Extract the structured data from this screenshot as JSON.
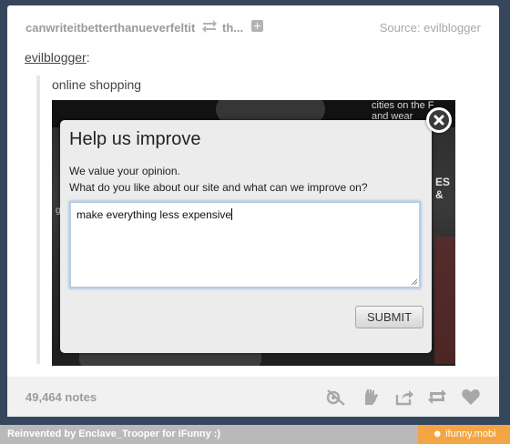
{
  "header": {
    "reblogger": "canwriteitbetterthanueverfeltit",
    "reblogged_from_short": "th...",
    "source_label": "Source: evilblogger"
  },
  "post": {
    "quoted_user": "evilblogger",
    "quoted_colon": ":",
    "caption": "online shopping"
  },
  "background_photo_text": {
    "top_right": "cities on the F",
    "top_right_2": "and wear",
    "mid_right": "ES &",
    "mid_left": "g i"
  },
  "dialog": {
    "title": "Help us improve",
    "line1": "We value your opinion.",
    "line2": "What do you like about our site and what can we improve on?",
    "input_value": "make everything less expensive",
    "submit_label": "SUBMIT"
  },
  "footer": {
    "notes": "49,464 notes",
    "icons": [
      "share-icon",
      "like-hand-icon",
      "share-arrow-icon",
      "reblog-icon",
      "heart-icon"
    ]
  },
  "banner": {
    "left_text": "Reinvented by Enclave_Trooper for iFunny :)",
    "right_text": "ifunny.mobi",
    "right_color": "#f3a543"
  }
}
